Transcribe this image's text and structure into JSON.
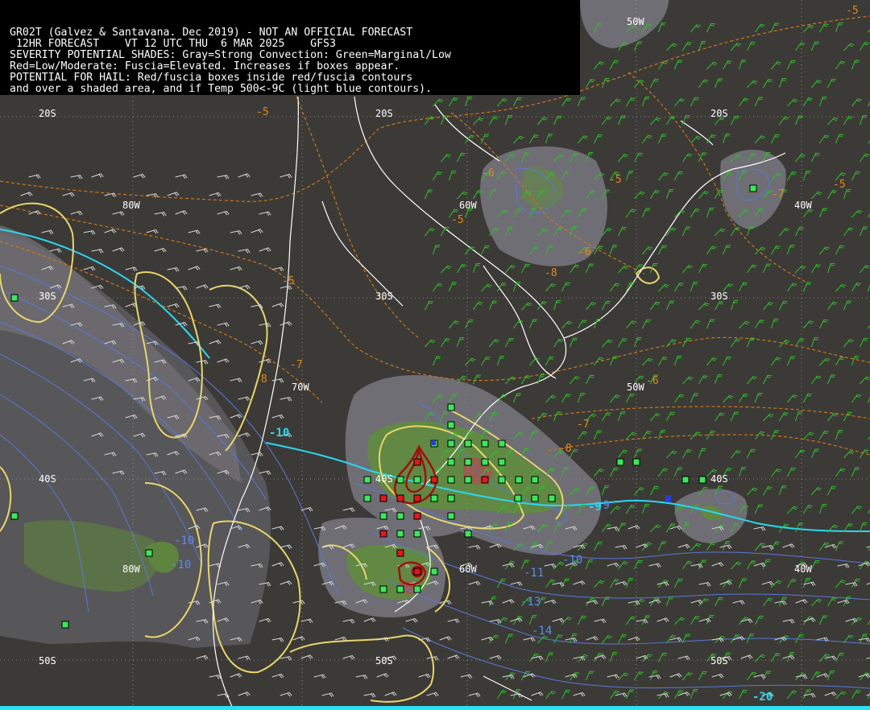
{
  "header": {
    "lines": [
      "GR02T (Galvez & Santavana. Dec 2019) - NOT AN OFFICIAL FORECAST",
      " 12HR FORECAST    VT 12 UTC THU  6 MAR 2025    GFS3",
      "SEVERITY POTENTIAL SHADES: Gray=Strong Convection: Green=Marginal/Low",
      "Red=Low/Moderate: Fuscia=Elevated. Increases if boxes appear.",
      "POTENTIAL FOR HAIL: Red/fuscia boxes inside red/fuscia contours",
      "and over a shaded area, and if Temp 500<-9C (light blue contours)."
    ]
  },
  "grid_labels": [
    "20S",
    "20S",
    "20S",
    "50W",
    "80W",
    "60W",
    "40W",
    "30S",
    "30S",
    "30S",
    "70W",
    "50W",
    "40S",
    "40S",
    "40S",
    "80W",
    "60W",
    "40W",
    "50S",
    "50S",
    "50S"
  ],
  "temperature_labels": [
    "-5",
    "-5",
    "-5",
    "-5",
    "-5",
    "-6",
    "-5",
    "-7",
    "-6",
    "-8",
    "-7",
    "-7",
    "-8",
    "-6",
    "-8"
  ],
  "temp500_labels": [
    "-9",
    "-10",
    "-10",
    "-11",
    "-13",
    "-14",
    "-10"
  ],
  "cold_labels": [
    "-10",
    "-9",
    "-20"
  ],
  "colors": {
    "background": "#3c3a37",
    "gray_shade": "#75747c",
    "green_shade": "#5f8e3a",
    "red_shade": "#9e5a50",
    "yellow_contour": "#e8d66a",
    "cyan_contour": "#29d8f0",
    "blue_contour": "#5a78d8",
    "orange_dashed": "#d97b12",
    "coastline": "#ffffff",
    "wind_barb": "#2fc02a",
    "wind_barb_white": "#d8d8d8",
    "hail_contour": "#a01010",
    "box_green": "#3ce85a",
    "box_red": "#e01818"
  }
}
